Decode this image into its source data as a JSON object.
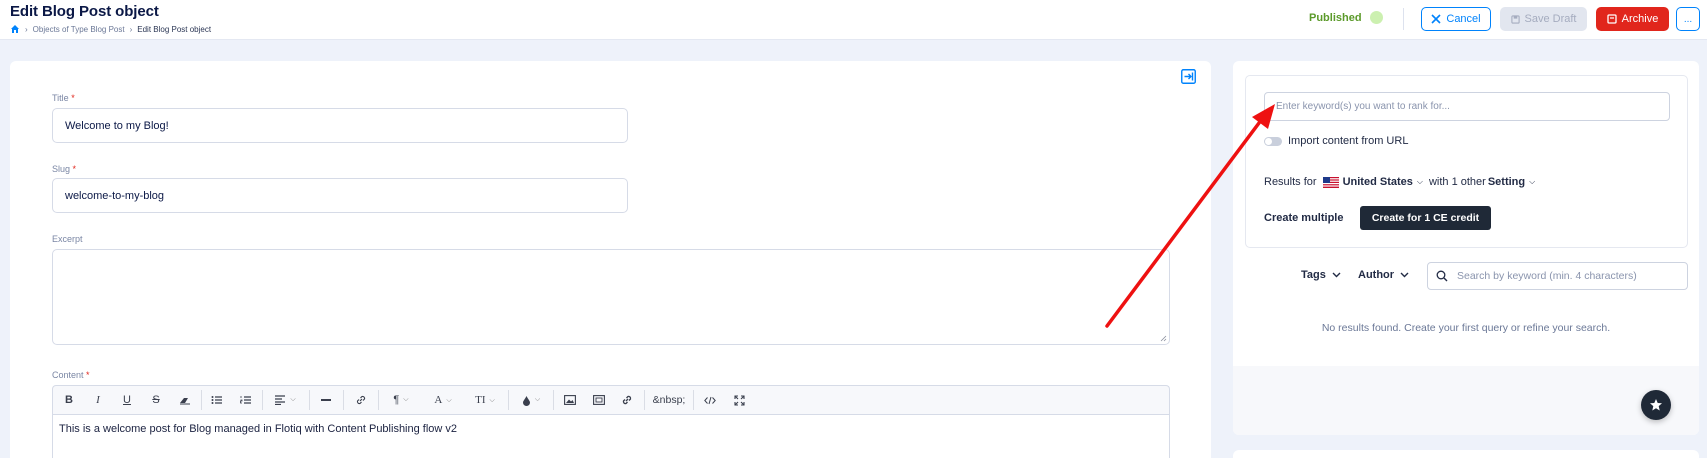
{
  "header": {
    "title": "Edit Blog Post object",
    "breadcrumb": [
      "Objects of Type Blog Post",
      "Edit Blog Post object"
    ],
    "status": "Published",
    "status_color": "#5b9a2a",
    "cancel_label": "Cancel",
    "save_draft_label": "Save Draft",
    "archive_label": "Archive",
    "more_label": "..."
  },
  "form": {
    "title_label": "Title",
    "title_value": "Welcome to my Blog!",
    "slug_label": "Slug",
    "slug_value": "welcome-to-my-blog",
    "excerpt_label": "Excerpt",
    "excerpt_value": "",
    "content_label": "Content",
    "required_mark": "*",
    "content_value": "This is a welcome post for Blog managed in Flotiq with Content Publishing flow v2",
    "toolbar": {
      "bold": "B",
      "italic": "I",
      "underline": "U",
      "strike": "S",
      "paragraph": "¶",
      "font_color": "A",
      "font_size": "TI",
      "nbsp": "&nbsp;"
    }
  },
  "seo": {
    "keyword_placeholder": "Enter keyword(s) you want to rank for...",
    "import_label": "Import content from URL",
    "results_for": "Results for",
    "country": "United States",
    "with_other": "with 1 other",
    "setting": "Setting",
    "create_multiple": "Create multiple",
    "create_button": "Create for 1 CE credit"
  },
  "filters": {
    "tags": "Tags",
    "author": "Author",
    "search_placeholder": "Search by keyword (min. 4 characters)",
    "no_results": "No results found. Create your first query or refine your search."
  },
  "colors": {
    "accent": "#0083fc",
    "danger": "#e1261c",
    "dark": "#1f2937",
    "annotation_arrow": "#ee1111"
  },
  "icons": [
    "home-icon",
    "chevron-right-icon",
    "close-icon",
    "save-icon",
    "archive-icon",
    "collapse-panel-icon",
    "link-icon",
    "image-icon",
    "code-icon",
    "fullscreen-icon",
    "search-icon",
    "star-icon",
    "us-flag-icon",
    "chevron-down-icon"
  ]
}
